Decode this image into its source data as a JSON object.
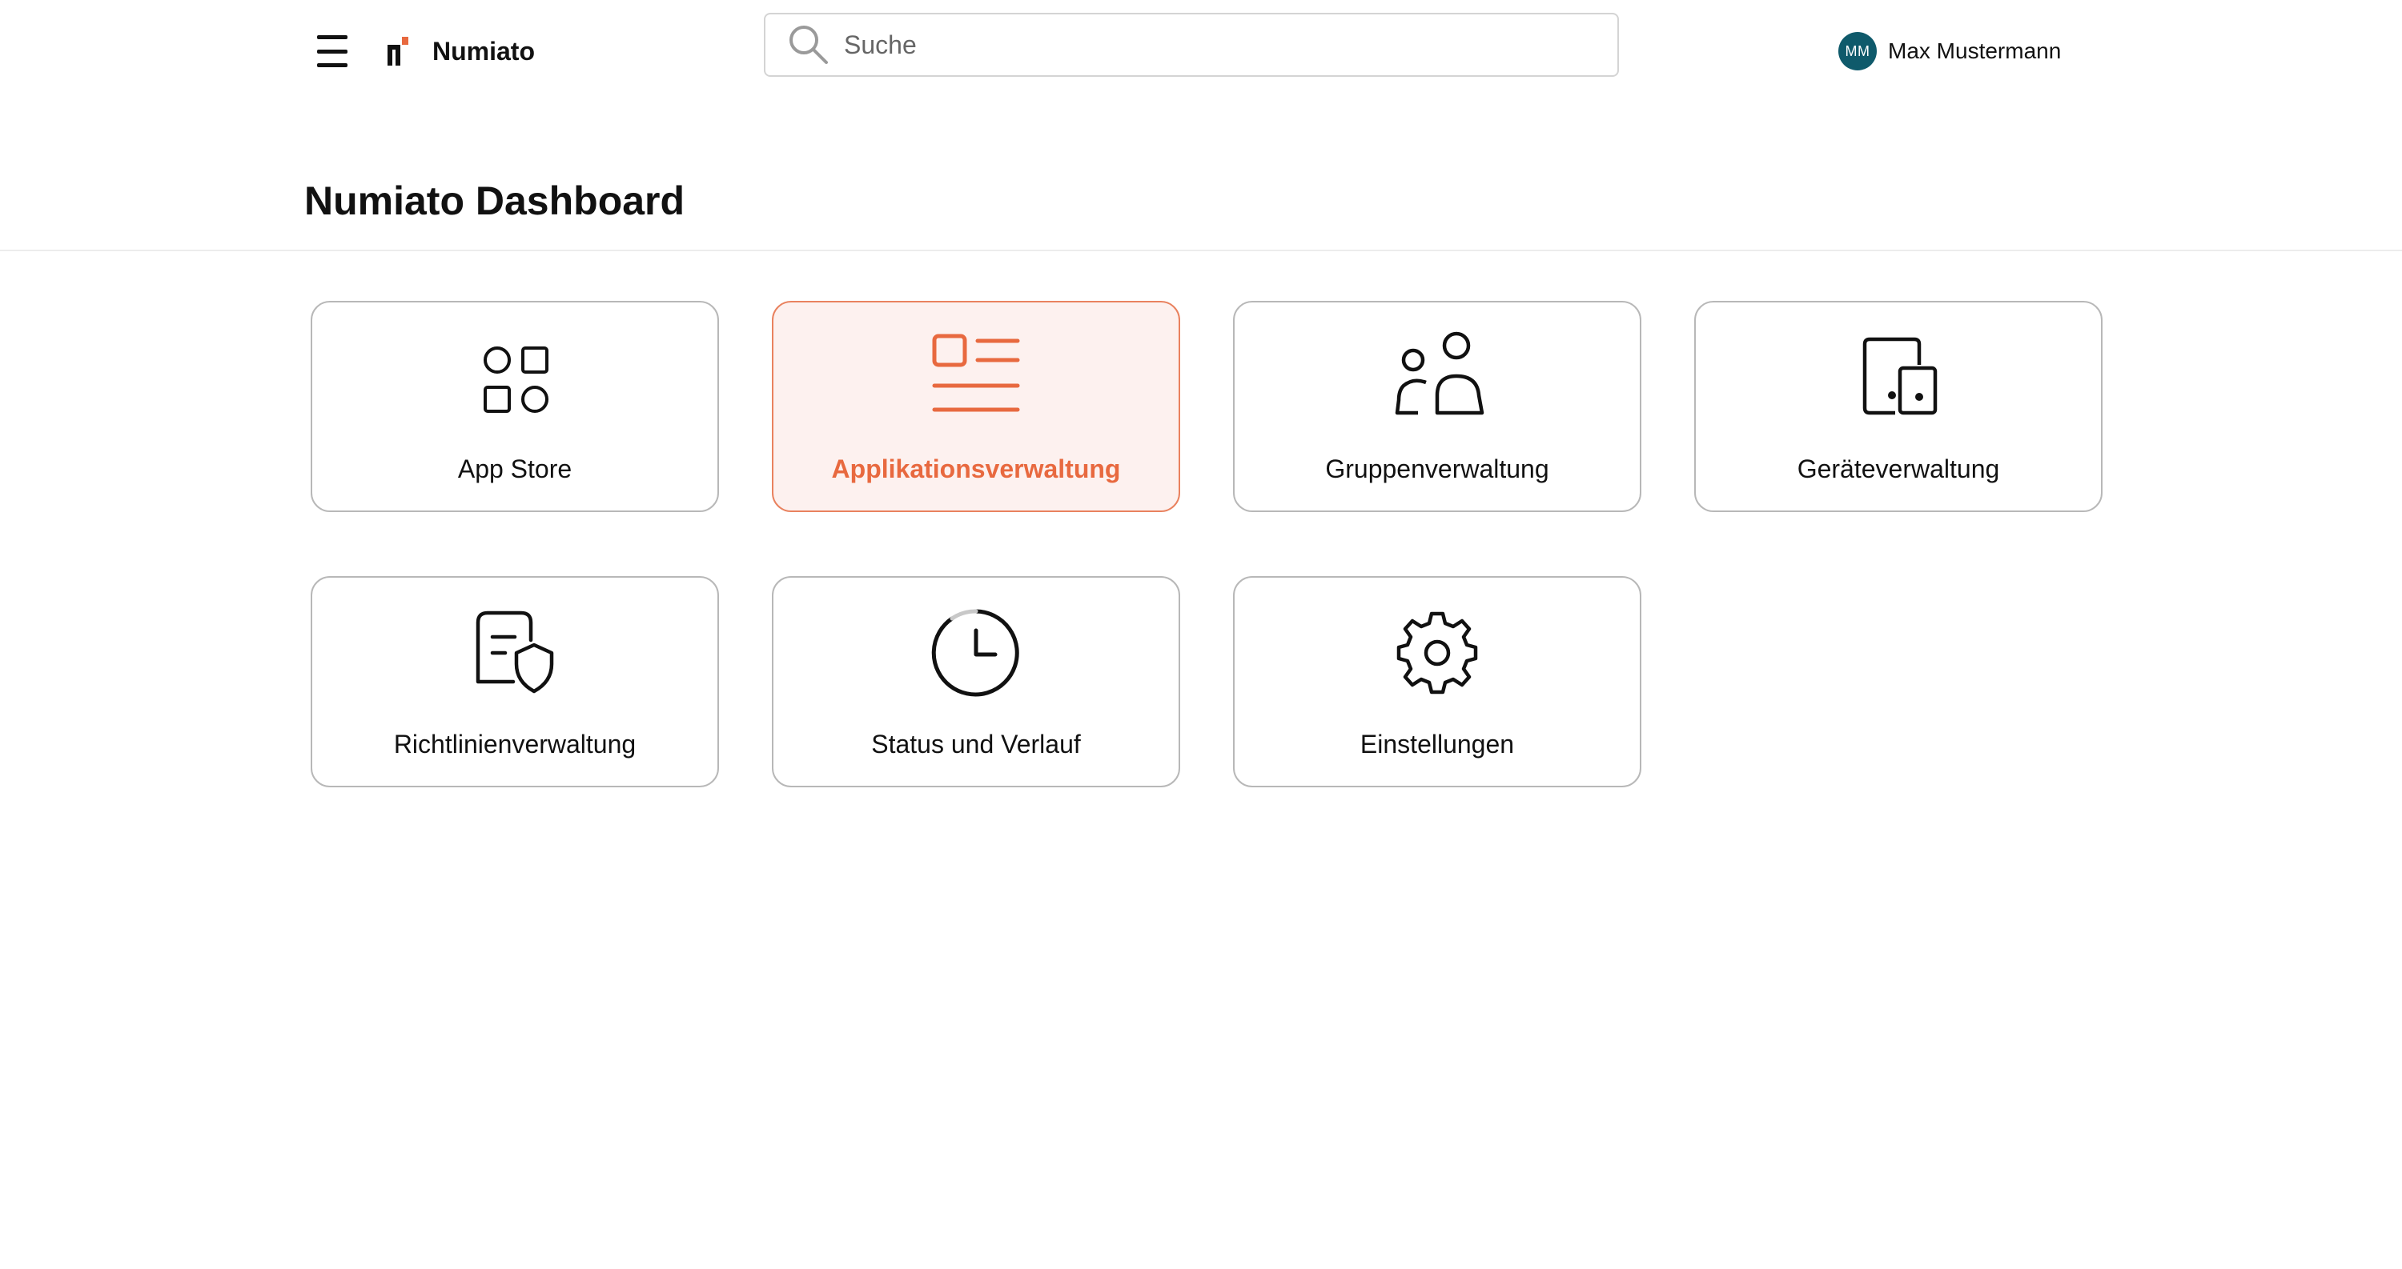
{
  "header": {
    "app_name": "Numiato",
    "menu_icon": "hamburger-icon",
    "logo_icon": "numiato-logo",
    "logo_accent_color": "#e8693f",
    "search": {
      "placeholder": "Suche",
      "value": ""
    },
    "user": {
      "initials": "MM",
      "name": "Max Mustermann",
      "avatar_color": "#0f5a6b"
    }
  },
  "page": {
    "title": "Numiato Dashboard"
  },
  "accent_color": "#e8693f",
  "tiles": [
    {
      "label": "App Store",
      "icon": "apps-grid-icon",
      "active": false
    },
    {
      "label": "Applikationsverwaltung",
      "icon": "list-icon",
      "active": true
    },
    {
      "label": "Gruppenverwaltung",
      "icon": "users-icon",
      "active": false
    },
    {
      "label": "Geräteverwaltung",
      "icon": "devices-icon",
      "active": false
    },
    {
      "label": "Richtlinienverwaltung",
      "icon": "policy-shield-icon",
      "active": false
    },
    {
      "label": "Status und Verlauf",
      "icon": "clock-icon",
      "active": false
    },
    {
      "label": "Einstellungen",
      "icon": "gear-icon",
      "active": false
    }
  ]
}
